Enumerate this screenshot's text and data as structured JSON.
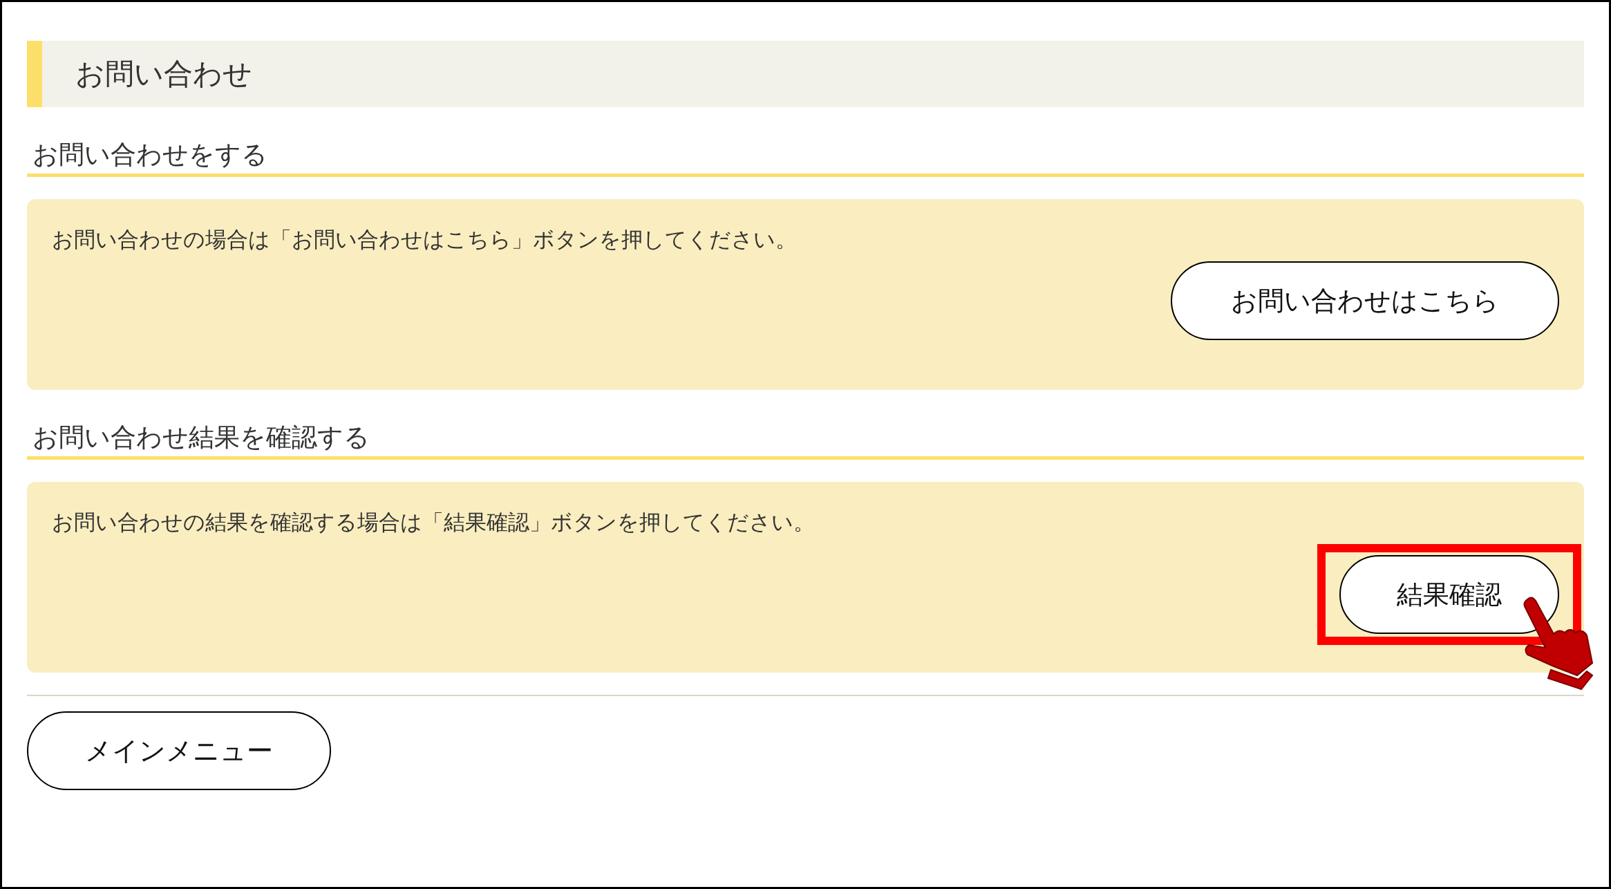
{
  "page_title": "お問い合わせ",
  "sections": [
    {
      "heading": "お問い合わせをする",
      "message": "お問い合わせの場合は「お問い合わせはこちら」ボタンを押してください。",
      "button": {
        "label": "お問い合わせはこちら",
        "highlighted": false
      }
    },
    {
      "heading": "お問い合わせ結果を確認する",
      "message": "お問い合わせの結果を確認する場合は「結果確認」ボタンを押してください。",
      "button": {
        "label": "結果確認",
        "highlighted": true
      }
    }
  ],
  "main_menu_button": "メインメニュー"
}
